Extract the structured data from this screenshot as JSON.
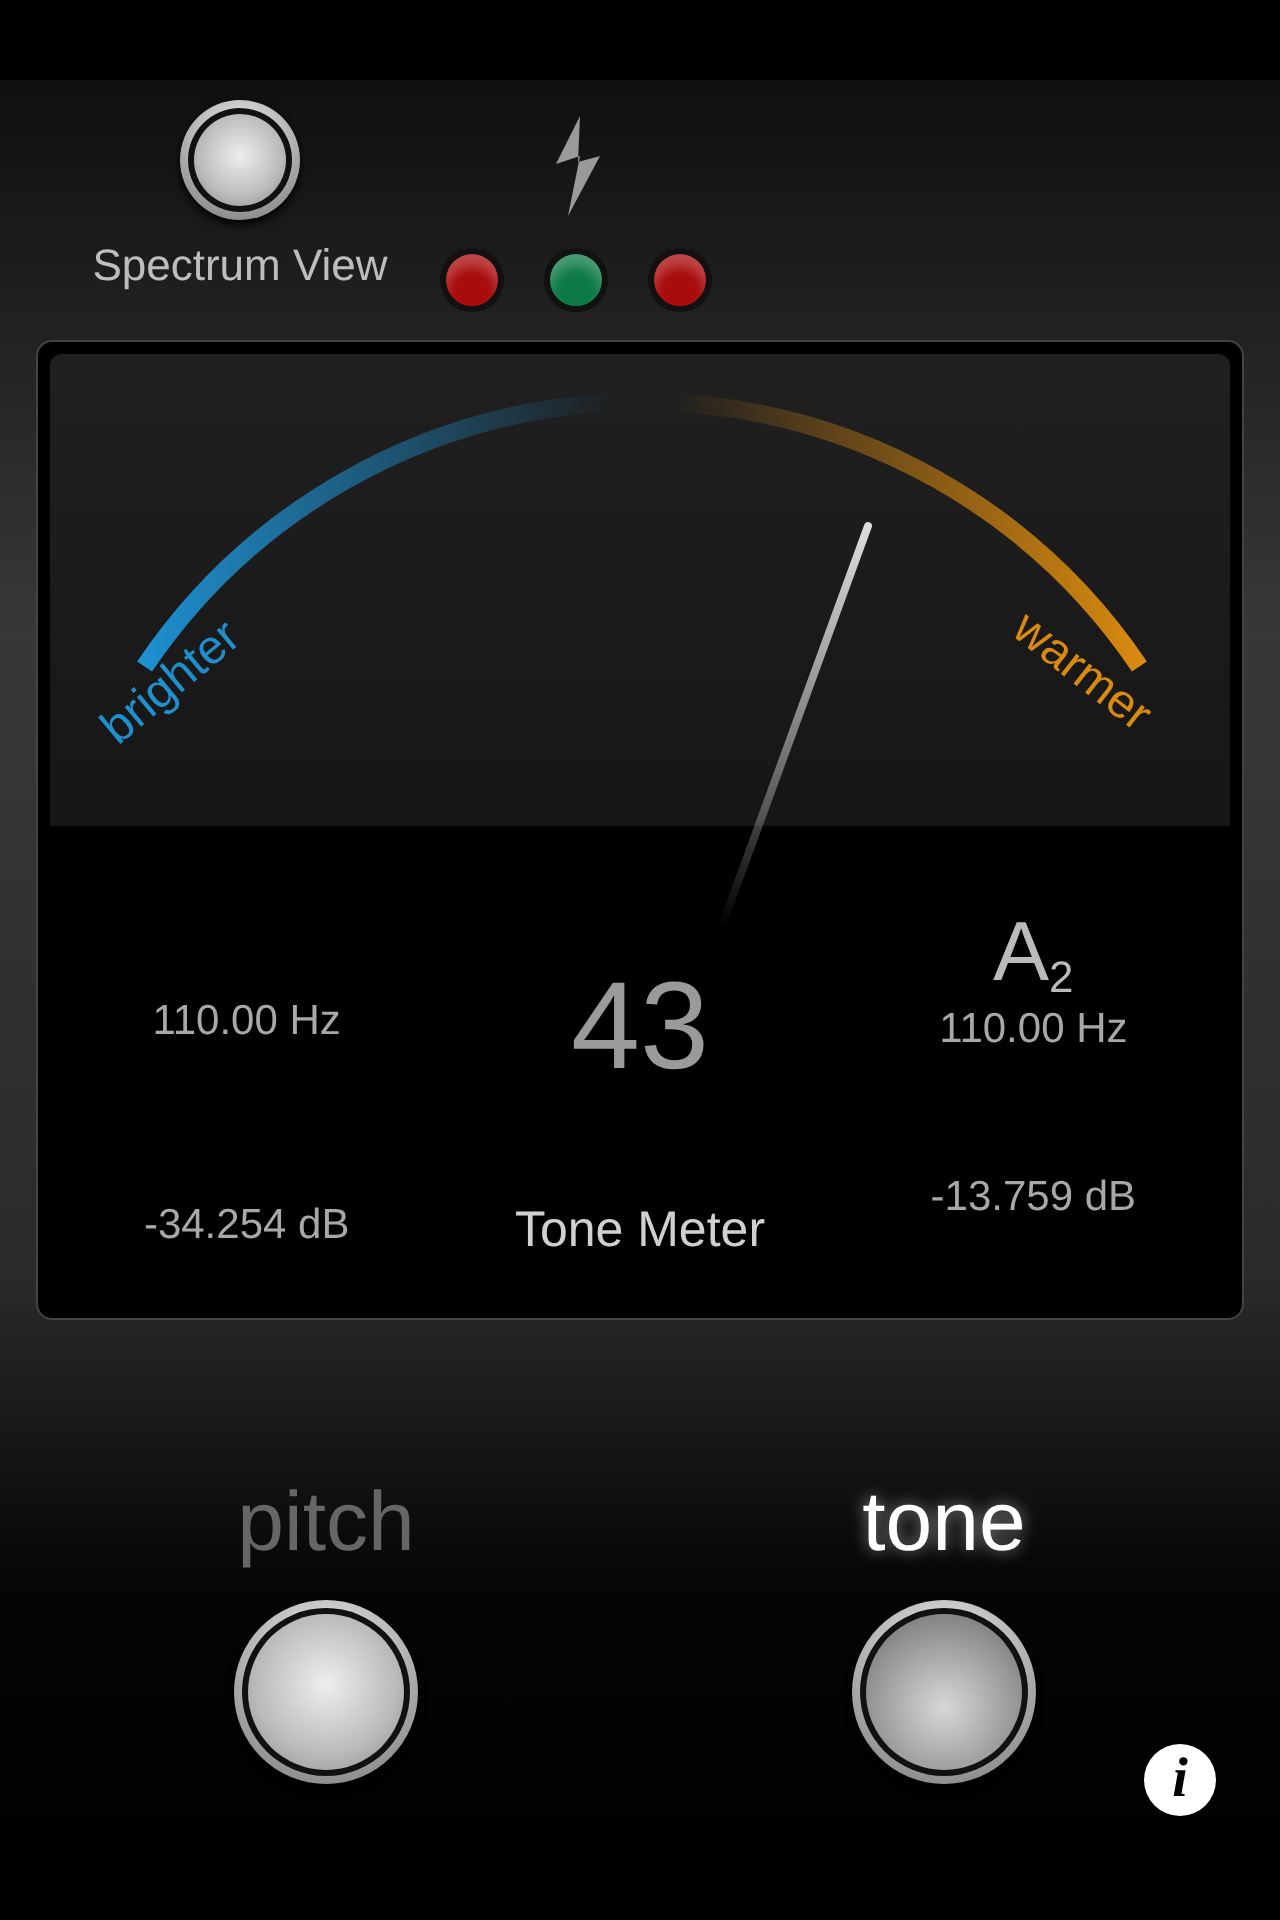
{
  "spectrum_button": {
    "label": "Spectrum View"
  },
  "lights": [
    {
      "color": "#a80c0c"
    },
    {
      "color": "#0d7a45"
    },
    {
      "color": "#a80c0c"
    }
  ],
  "meter": {
    "left_label": "brighter",
    "right_label": "warmer",
    "left_frequency": "110.00 Hz",
    "left_db": "-34.254 dB",
    "value": "43",
    "title": "Tone Meter",
    "note": "A$_{2}$",
    "right_frequency": "110.00 Hz",
    "right_db": "-13.759 dB"
  },
  "modes": [
    {
      "label": "pitch",
      "selected": false
    },
    {
      "label": "tone",
      "selected": true
    }
  ],
  "info_button": "i"
}
